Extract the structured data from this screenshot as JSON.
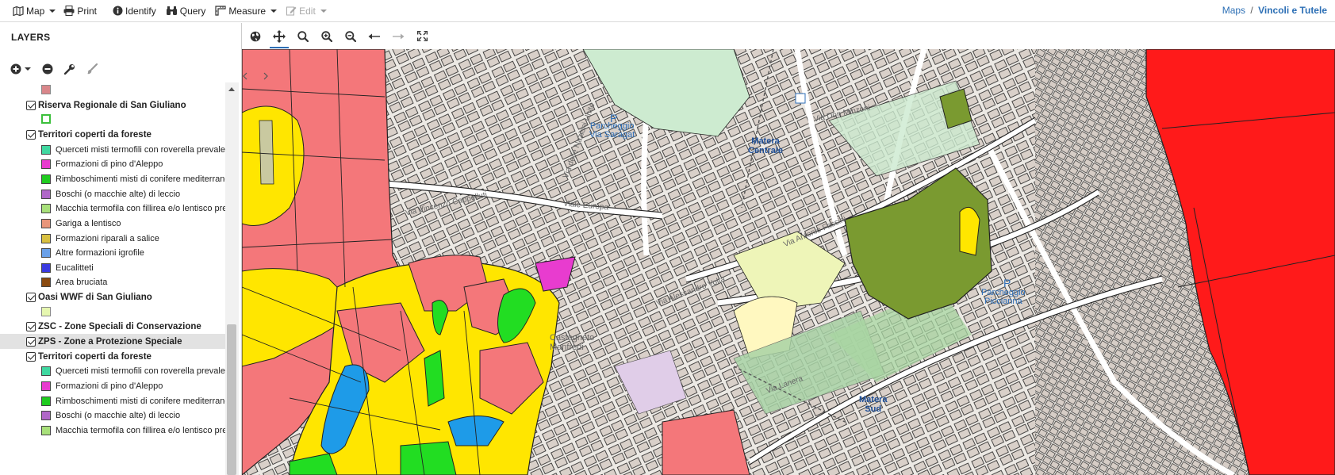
{
  "toolbar": {
    "map_label": "Map",
    "print_label": "Print",
    "identify_label": "Identify",
    "query_label": "Query",
    "measure_label": "Measure",
    "edit_label": "Edit"
  },
  "breadcrumb": {
    "maps_label": "Maps",
    "separator": "/",
    "current_label": "Vincoli e Tutele"
  },
  "layers_panel": {
    "title": "LAYERS",
    "rows": [
      {
        "type": "swatch",
        "color": "#d9868a"
      },
      {
        "type": "group",
        "label": "Riserva Regionale di San Giuliano"
      },
      {
        "type": "swatch",
        "color": "#3bbf3b",
        "dashed": true
      },
      {
        "type": "group",
        "label": "Territori coperti da foreste"
      },
      {
        "type": "item",
        "label": "Querceti misti termofili con roverella prevalente",
        "color": "#3fd8a0"
      },
      {
        "type": "item",
        "label": "Formazioni di pino d'Aleppo",
        "color": "#e83ccf"
      },
      {
        "type": "item",
        "label": "Rimboschimenti misti di conifere mediterranee (pi",
        "color": "#1fcc1f"
      },
      {
        "type": "item",
        "label": "Boschi (o macchie alte) di leccio",
        "color": "#b067c8"
      },
      {
        "type": "item",
        "label": "Macchia termofila con fillirea e/o lentisco prevale",
        "color": "#a8e07a"
      },
      {
        "type": "item",
        "label": "Gariga a lentisco",
        "color": "#e8957a"
      },
      {
        "type": "item",
        "label": "Formazioni riparali a salice",
        "color": "#d8c040"
      },
      {
        "type": "item",
        "label": "Altre formazioni igrofile",
        "color": "#6aa0e8"
      },
      {
        "type": "item",
        "label": "Eucalitteti",
        "color": "#3a3ae0"
      },
      {
        "type": "item",
        "label": "Area bruciata",
        "color": "#8a4a10"
      },
      {
        "type": "group",
        "label": "Oasi WWF di San Giuliano"
      },
      {
        "type": "swatch",
        "color": "#e6f7b0"
      },
      {
        "type": "group",
        "label": "ZSC - Zone Speciali di Conservazione"
      },
      {
        "type": "group",
        "label": "ZPS - Zone a Protezione Speciale",
        "selected": true
      },
      {
        "type": "group",
        "label": "Territori coperti da foreste"
      },
      {
        "type": "item",
        "label": "Querceti misti termofili con roverella prevalente",
        "color": "#3fd8a0"
      },
      {
        "type": "item",
        "label": "Formazioni di pino d'Aleppo",
        "color": "#e83ccf"
      },
      {
        "type": "item",
        "label": "Rimboschimenti misti di conifere mediterranee (pi",
        "color": "#1fcc1f"
      },
      {
        "type": "item",
        "label": "Boschi (o macchie alte) di leccio",
        "color": "#b067c8"
      },
      {
        "type": "item",
        "label": "Macchia termofila con fillirea e/o lentisco prevale",
        "color": "#a8e07a"
      }
    ]
  },
  "map_toolbar": {
    "tools": [
      "globe-icon",
      "pan-icon",
      "search-icon",
      "zoom-in-icon",
      "zoom-out-icon",
      "back-icon",
      "forward-icon",
      "fullscreen-icon"
    ],
    "active_tool": "pan-icon"
  },
  "map": {
    "labels": {
      "via_vincenzo": "Via Vincenzo Cappelluti",
      "viale_europa": "Viale Europa",
      "via_nazioni": "Via delle Nazioni Unite",
      "via_fassini": "Via Antonio Fassini",
      "via_lanera": "Via Lanera",
      "parcheggio_1": "Parcheggio\nVia Saragat",
      "matera_centrale": "Matera\nCentrale",
      "parcheggio_2": "Parcheggio\nPiccianna",
      "matera_sud": "Matera\nSud",
      "castagneto": "Castagneto\nManfredi",
      "via_don_minzoni": "Via Don Minzoni",
      "via_alessandro": "Via Alessandro Volta"
    },
    "colors": {
      "pink_zone": "#f4777a",
      "yellow_zone": "#ffe600",
      "green_zone": "#22dd22",
      "blue_zone": "#1e9be8",
      "olive_zone": "#7a9a30",
      "red_zone": "#ff1a1a",
      "base": "#ece9e4"
    }
  }
}
